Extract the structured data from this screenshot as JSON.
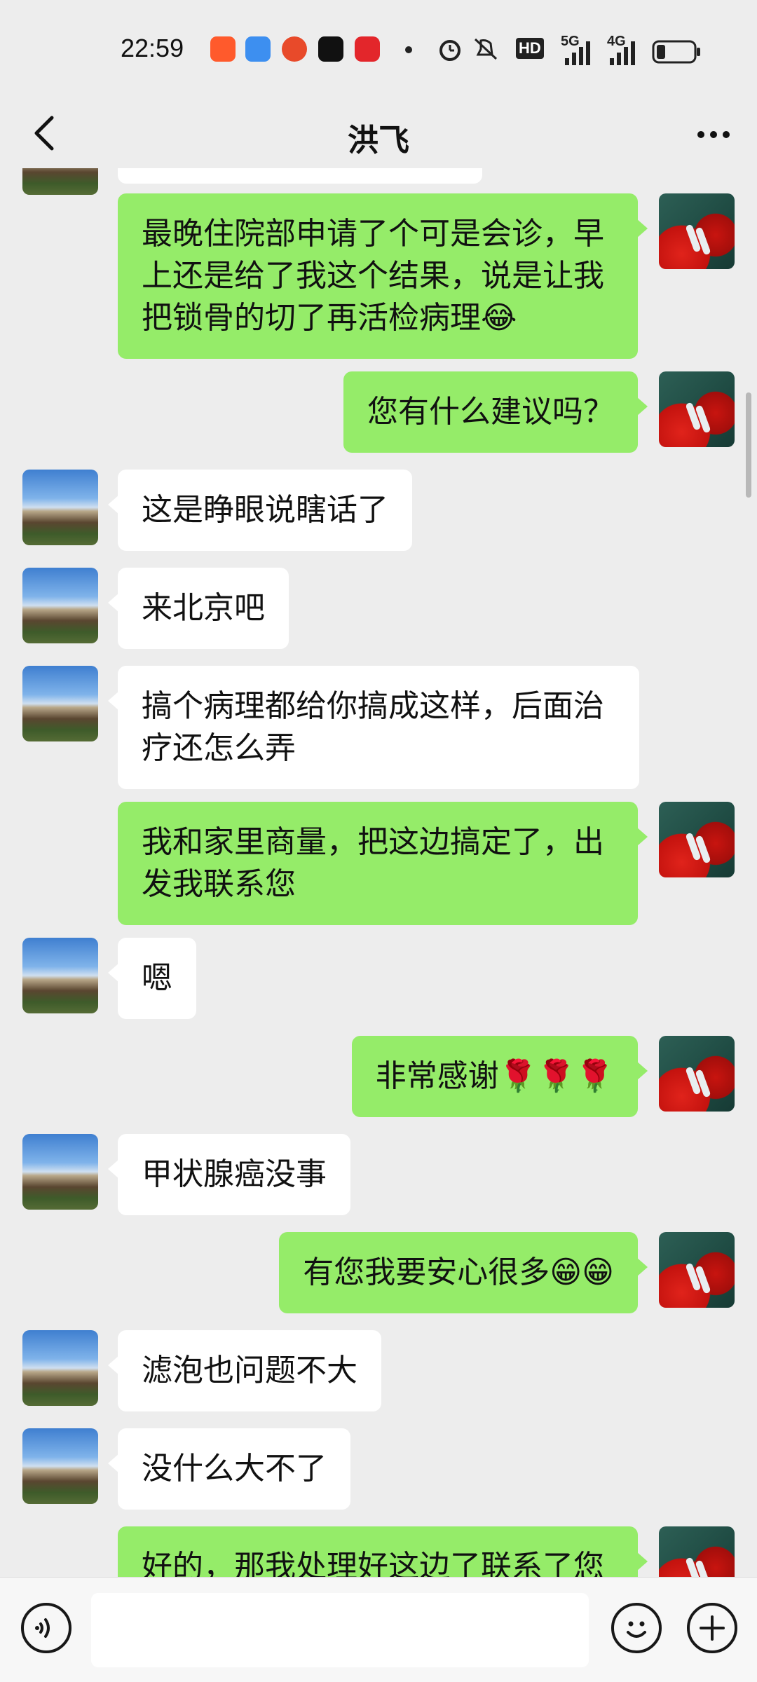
{
  "status_bar": {
    "time": "22:59",
    "network_label": "5G",
    "network_label_2": "4G",
    "hd_label": "HD"
  },
  "header": {
    "title": "洪飞"
  },
  "messages": [
    {
      "side": "out",
      "text": "最晚住院部申请了个可是会诊，早上还是给了我这个结果，说是让我把锁骨的切了再活检病理😂"
    },
    {
      "side": "out",
      "text": "您有什么建议吗？"
    },
    {
      "side": "in",
      "text": "这是睁眼说瞎话了"
    },
    {
      "side": "in",
      "text": "来北京吧"
    },
    {
      "side": "in",
      "text": "搞个病理都给你搞成这样，后面治疗还怎么弄"
    },
    {
      "side": "out",
      "text": "我和家里商量，把这边搞定了，出发我联系您"
    },
    {
      "side": "in",
      "text": "嗯"
    },
    {
      "side": "out",
      "text": "非常感谢🌹🌹🌹"
    },
    {
      "side": "in",
      "text": "甲状腺癌没事"
    },
    {
      "side": "out",
      "text": "有您我要安心很多😁😁"
    },
    {
      "side": "in",
      "text": "滤泡也问题不大"
    },
    {
      "side": "in",
      "text": "没什么大不了"
    },
    {
      "side": "out",
      "text": "好的，那我处理好这边了联系了您"
    }
  ],
  "input": {
    "placeholder": ""
  },
  "colors": {
    "outgoing_bubble": "#95ec69",
    "incoming_bubble": "#ffffff",
    "background": "#ededed"
  },
  "icons": [
    "back-arrow-icon",
    "more-icon",
    "voice-icon",
    "emoji-icon",
    "plus-icon"
  ]
}
